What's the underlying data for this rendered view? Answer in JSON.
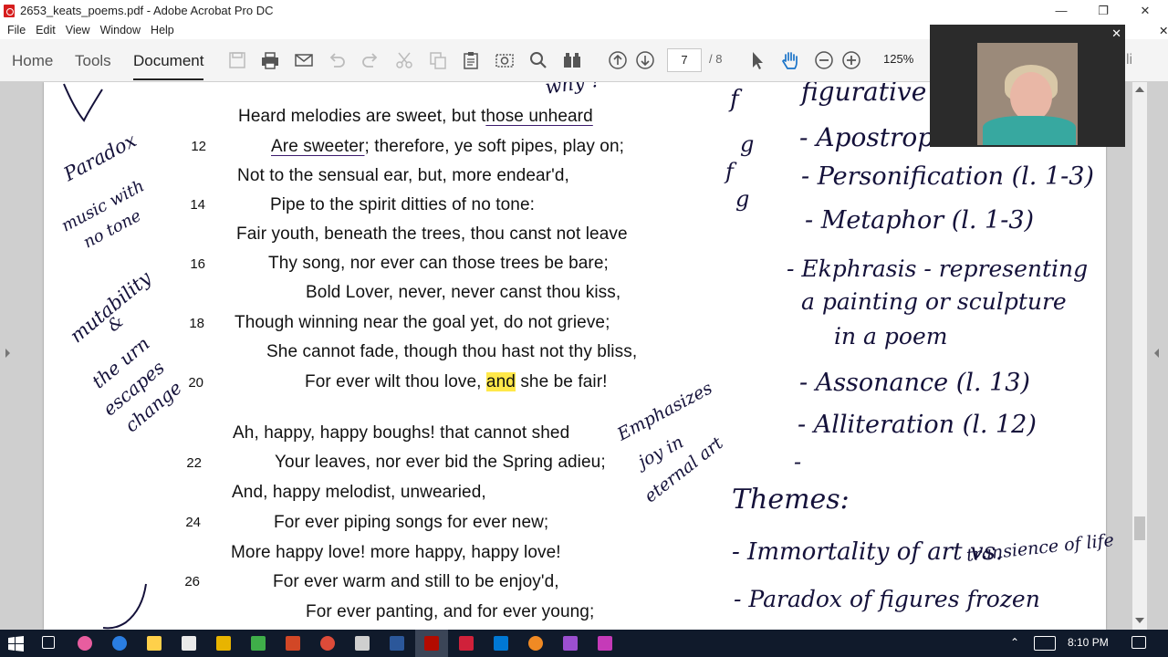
{
  "window": {
    "title": "2653_keats_poems.pdf - Adobe Acrobat Pro DC"
  },
  "menu": [
    "File",
    "Edit",
    "View",
    "Window",
    "Help"
  ],
  "toolbar": {
    "tabs": [
      "Home",
      "Tools",
      "Document"
    ],
    "current_page": "7",
    "page_total": "/ 8",
    "zoom": "125%",
    "right_fragment": "li"
  },
  "poem": {
    "lines": [
      {
        "pre": "Heard melodies are sweet, but t",
        "u": "hose unheard",
        "post": ""
      },
      {
        "pre": "",
        "u": "Are sweeter",
        "post": "; therefore, ye soft pipes, play on;"
      },
      {
        "pre": "Not to the sensual ear, but, more endear'd,",
        "u": "",
        "post": ""
      },
      {
        "pre": "Pipe to the spirit ditties of no tone:",
        "u": "",
        "post": ""
      },
      {
        "pre": "Fair youth, beneath the trees, thou canst not leave",
        "u": "",
        "post": ""
      },
      {
        "pre": "Thy song, nor ever can those trees be bare;",
        "u": "",
        "post": ""
      },
      {
        "pre": "Bold Lover, never, never canst thou kiss,",
        "u": "",
        "post": ""
      },
      {
        "pre": "Though winning near the goal yet, do not grieve;",
        "u": "",
        "post": ""
      },
      {
        "pre": "She cannot fade, though thou hast not thy bliss,",
        "u": "",
        "post": ""
      },
      {
        "pre": "For ever wilt thou love, ",
        "hl": "and",
        "post": " she be fair!"
      },
      {
        "pre": "Ah, happy, happy boughs! that cannot shed",
        "u": "",
        "post": ""
      },
      {
        "pre": "Your leaves, nor ever bid the Spring adieu;",
        "u": "",
        "post": ""
      },
      {
        "pre": "And, happy melodist, unwearied,",
        "u": "",
        "post": ""
      },
      {
        "pre": "For ever piping songs for ever new;",
        "u": "",
        "post": ""
      },
      {
        "pre": "More happy love! more happy, happy love!",
        "u": "",
        "post": ""
      },
      {
        "pre": "For ever warm and still to be enjoy'd,",
        "u": "",
        "post": ""
      },
      {
        "pre": "For ever panting, and for ever young;",
        "u": "",
        "post": ""
      }
    ],
    "line_numbers": [
      "12",
      "14",
      "16",
      "18",
      "20",
      "22",
      "24",
      "26"
    ]
  },
  "annotations": {
    "left": [
      "Paradox",
      "music with",
      "no tone",
      "mutability",
      "&",
      "the urn",
      "escapes",
      "change"
    ],
    "top_mid": "why ?",
    "rhyme": [
      "f",
      "g",
      "f",
      "g"
    ],
    "middle": [
      "Emphasizes",
      "joy in",
      "eternal art"
    ],
    "right": [
      "figurative",
      "- Apostrophe",
      "- Personification (l. 1-3)",
      "- Metaphor (l. 1-3)",
      "- Ekphrasis - representing",
      "a painting or sculpture",
      "in a poem",
      "- Assonance (l. 13)",
      "- Alliteration (l. 12)",
      "-"
    ],
    "themes_title": "Themes:",
    "themes": [
      "- Immortality of art vs.",
      "transience of life",
      "- Paradox of figures frozen"
    ]
  },
  "taskbar": {
    "time": "8:10 PM"
  }
}
